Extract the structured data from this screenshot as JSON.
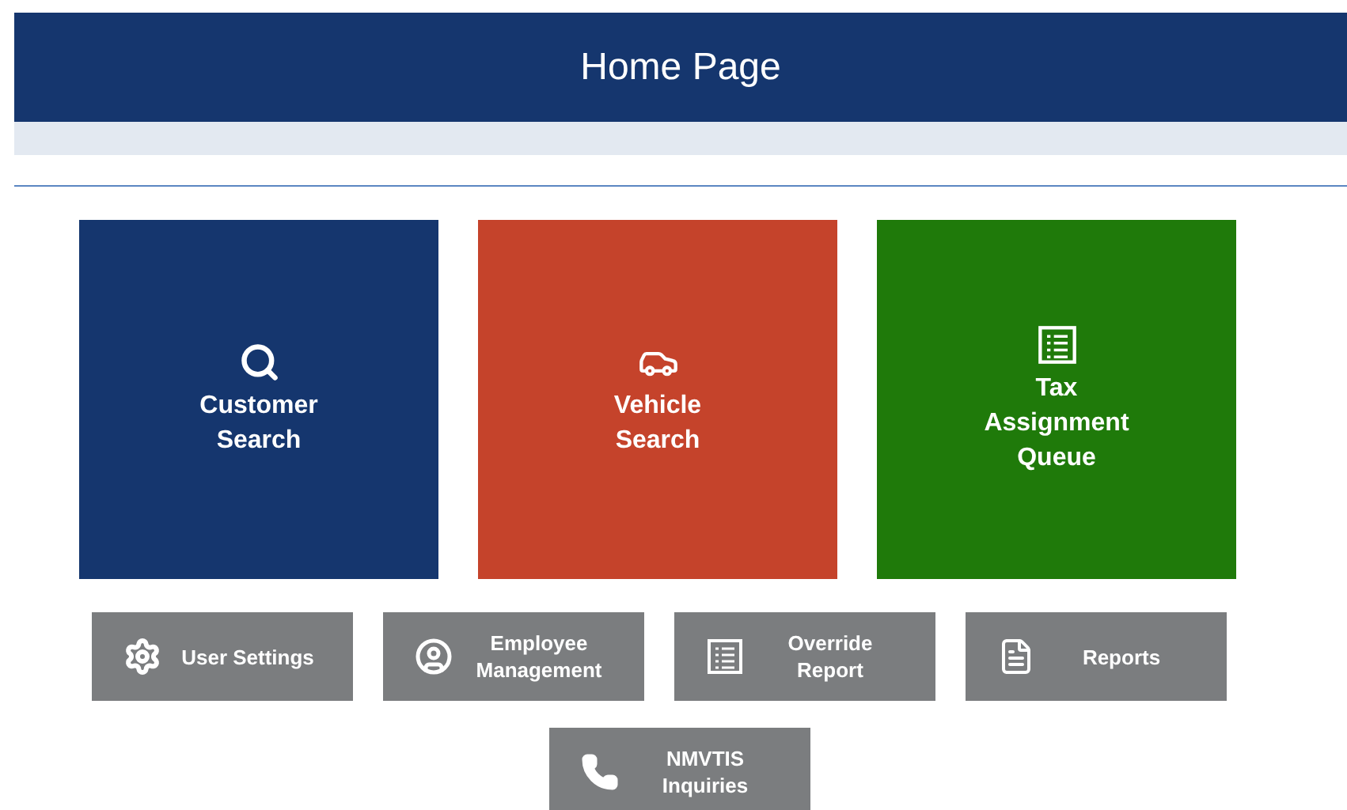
{
  "header": {
    "title": "Home Page"
  },
  "tiles": [
    {
      "label": "Customer Search",
      "kind": "search",
      "color": "#15366e"
    },
    {
      "label": "Vehicle Search",
      "kind": "car",
      "color": "#c5432b"
    },
    {
      "label": "Tax Assignment Queue",
      "kind": "list",
      "color": "#1f7a0a"
    }
  ],
  "buttons": [
    {
      "label": "User Settings",
      "kind": "gear"
    },
    {
      "label": "Employee Management",
      "kind": "user"
    },
    {
      "label": "Override Report",
      "kind": "list"
    },
    {
      "label": "Reports",
      "kind": "file"
    },
    {
      "label": "NMVTIS Inquiries",
      "kind": "phone"
    }
  ]
}
